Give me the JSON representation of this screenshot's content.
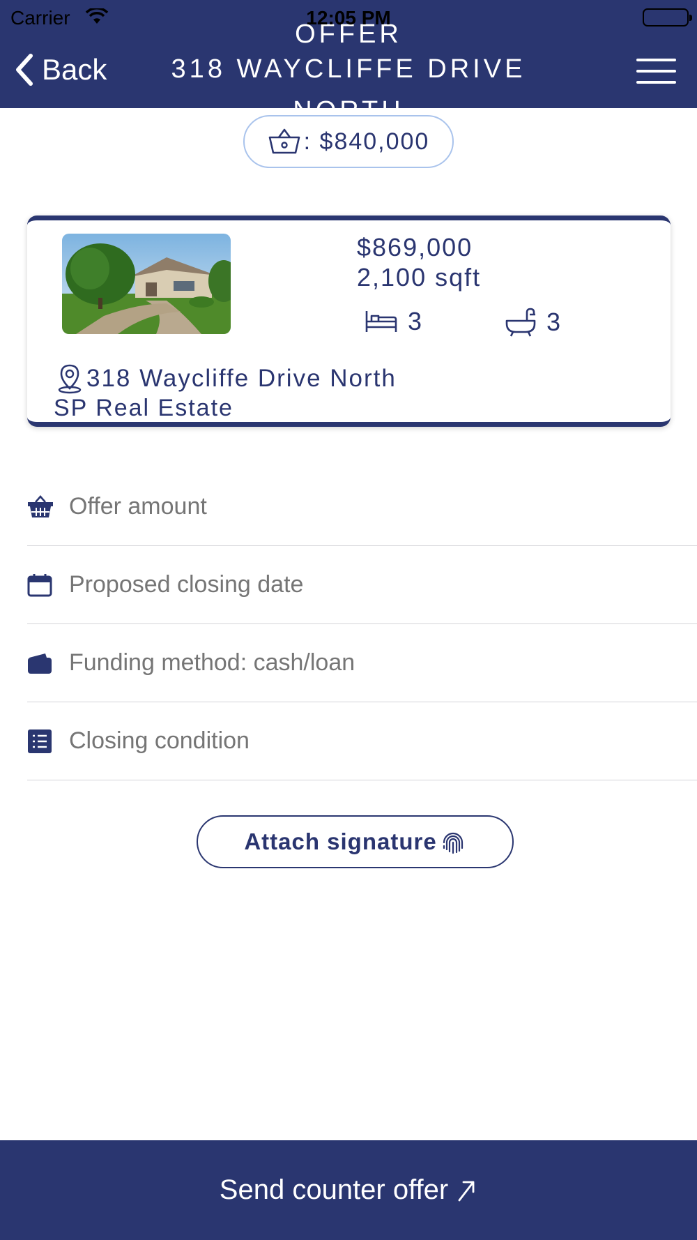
{
  "status_bar": {
    "carrier": "Carrier",
    "time": "12:05 PM"
  },
  "nav": {
    "back_label": "Back",
    "title_top_fragment": "OFFER",
    "title": "318 WAYCLIFFE DRIVE",
    "title_bottom_fragment": "NORTH"
  },
  "current_offer": {
    "icon": "basket-icon",
    "text": ": $840,000"
  },
  "property": {
    "price": "$869,000",
    "area": "2,100 sqft",
    "beds": "3",
    "baths": "3",
    "address": "318 Waycliffe Drive North",
    "agency": "SP Real Estate"
  },
  "form": {
    "offer_amount_placeholder": "Offer amount",
    "closing_date_placeholder": "Proposed closing date",
    "funding_placeholder": "Funding method: cash/loan",
    "closing_condition_placeholder": "Closing condition"
  },
  "signature_button": {
    "label": "Attach signature"
  },
  "footer": {
    "label": "Send counter offer"
  },
  "colors": {
    "primary": "#2a3670",
    "pill_border": "#a9c3ec",
    "placeholder": "#8e8e93"
  }
}
